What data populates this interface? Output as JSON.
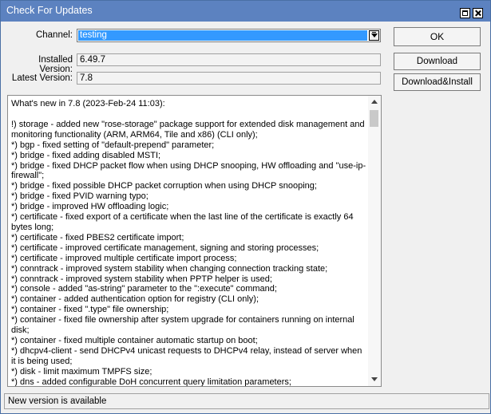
{
  "window": {
    "title": "Check For Updates"
  },
  "form": {
    "channel_label": "Channel:",
    "channel_value": "testing",
    "installed_label": "Installed Version:",
    "installed_value": "6.49.7",
    "latest_label": "Latest Version:",
    "latest_value": "7.8"
  },
  "buttons": {
    "ok": "OK",
    "download": "Download",
    "download_install": "Download&Install"
  },
  "notes": {
    "header": "What's new in 7.8 (2023-Feb-24 11:03):",
    "lines": [
      "!) storage - added new \"rose-storage\" package support for extended disk management and monitoring functionality (ARM, ARM64, Tile and x86) (CLI only);",
      "*) bgp - fixed setting of \"default-prepend\" parameter;",
      "*) bridge - fixed adding disabled MSTI;",
      "*) bridge - fixed DHCP packet flow when using DHCP snooping, HW offloading and \"use-ip-firewall\";",
      "*) bridge - fixed possible DHCP packet corruption when using DHCP snooping;",
      "*) bridge - fixed PVID warning typo;",
      "*) bridge - improved HW offloading logic;",
      "*) certificate - fixed export of a certificate when the last line of the certificate is exactly 64 bytes long;",
      "*) certificate - fixed PBES2 certificate import;",
      "*) certificate - improved certificate management, signing and storing processes;",
      "*) certificate - improved multiple certificate import process;",
      "*) conntrack - improved system stability when changing connection tracking state;",
      "*) conntrack - improved system stability when PPTP helper is used;",
      "*) console - added \"as-string\" parameter to the \":execute\" command;",
      "*) container - added authentication option for registry (CLI only);",
      "*) container - fixed \".type\" file ownership;",
      "*) container - fixed file ownership after system upgrade for containers running on internal disk;",
      "*) container - fixed multiple container automatic startup on boot;",
      "*) dhcpv4-client - send DHCPv4 unicast requests to DHCPv4 relay, instead of server when it is being used;",
      "*) disk - limit maximum TMPFS size;",
      "*) dns - added configurable DoH concurrent query limitation parameters;"
    ]
  },
  "status": {
    "text": "New version is available"
  }
}
